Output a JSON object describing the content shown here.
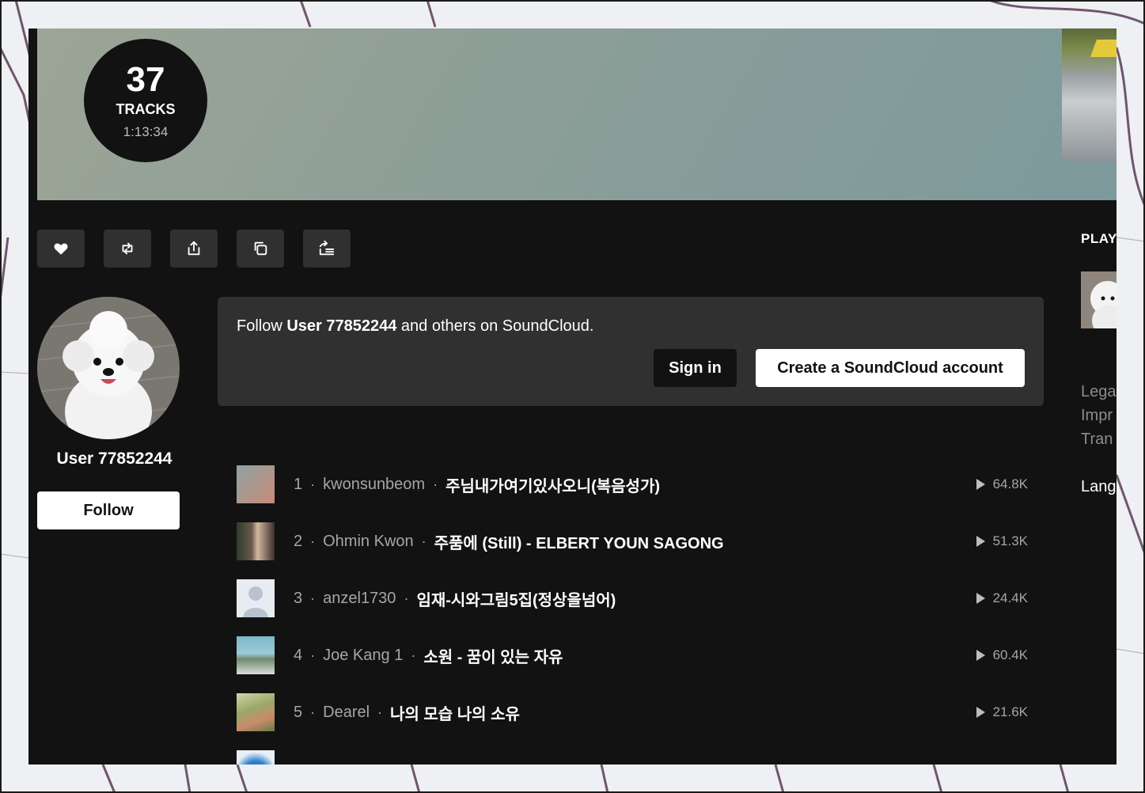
{
  "hero": {
    "track_count": "37",
    "track_label": "TRACKS",
    "duration": "1:13:34"
  },
  "actions": [
    {
      "name": "like-button",
      "icon": "heart-icon"
    },
    {
      "name": "repost-button",
      "icon": "repost-icon"
    },
    {
      "name": "share-button",
      "icon": "share-icon"
    },
    {
      "name": "copy-link-button",
      "icon": "copy-icon"
    },
    {
      "name": "add-to-queue-button",
      "icon": "add-to-queue-icon"
    }
  ],
  "user": {
    "name": "User 77852244",
    "follow_label": "Follow"
  },
  "follow_card": {
    "text_before": "Follow ",
    "user": "User 77852244",
    "text_after": " and others on SoundCloud.",
    "signin_label": "Sign in",
    "create_label": "Create a SoundCloud account"
  },
  "tracks": [
    {
      "num": "1",
      "artist": "kwonsunbeom",
      "title": "주님내가여기있사오니(복음성가)",
      "plays": "64.8K"
    },
    {
      "num": "2",
      "artist": "Ohmin Kwon",
      "title": "주품에 (Still) - ELBERT YOUN SAGONG",
      "plays": "51.3K"
    },
    {
      "num": "3",
      "artist": "anzel1730",
      "title": "임재-시와그림5집(정상을넘어)",
      "plays": "24.4K"
    },
    {
      "num": "4",
      "artist": "Joe Kang 1",
      "title": "소원 - 꿈이 있는 자유",
      "plays": "60.4K"
    },
    {
      "num": "5",
      "artist": "Dearel",
      "title": "나의 모습 나의 소유",
      "plays": "21.6K"
    }
  ],
  "sidebar": {
    "heading": "PLAY",
    "links": [
      "Lega",
      "Impr",
      "Tran"
    ],
    "language": "Lang"
  },
  "colors": {
    "app_bg": "#121212",
    "card_bg": "#303030",
    "muted_text": "#a6a6a6"
  }
}
